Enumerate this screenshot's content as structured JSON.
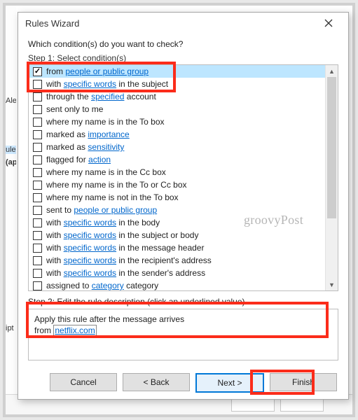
{
  "window": {
    "title": "Rules Wizard",
    "prompt": "Which condition(s) do you want to check?",
    "step1_label": "Step 1: Select condition(s)",
    "step2_label": "Step 2: Edit the rule description (click an underlined value)"
  },
  "left_fragments": {
    "a": "Ale",
    "b": "ule",
    "c": "(ap",
    "d": "ipt"
  },
  "conditions": [
    {
      "checked": true,
      "selected": true,
      "pre": "from ",
      "link": "people or public group",
      "post": ""
    },
    {
      "checked": false,
      "selected": false,
      "pre": "with ",
      "link": "specific words",
      "post": " in the subject"
    },
    {
      "checked": false,
      "selected": false,
      "pre": "through the ",
      "link": "specified",
      "post": " account"
    },
    {
      "checked": false,
      "selected": false,
      "pre": "sent only to me",
      "link": "",
      "post": ""
    },
    {
      "checked": false,
      "selected": false,
      "pre": "where my name is in the To box",
      "link": "",
      "post": ""
    },
    {
      "checked": false,
      "selected": false,
      "pre": "marked as ",
      "link": "importance",
      "post": ""
    },
    {
      "checked": false,
      "selected": false,
      "pre": "marked as ",
      "link": "sensitivity",
      "post": ""
    },
    {
      "checked": false,
      "selected": false,
      "pre": "flagged for ",
      "link": "action",
      "post": ""
    },
    {
      "checked": false,
      "selected": false,
      "pre": "where my name is in the Cc box",
      "link": "",
      "post": ""
    },
    {
      "checked": false,
      "selected": false,
      "pre": "where my name is in the To or Cc box",
      "link": "",
      "post": ""
    },
    {
      "checked": false,
      "selected": false,
      "pre": "where my name is not in the To box",
      "link": "",
      "post": ""
    },
    {
      "checked": false,
      "selected": false,
      "pre": "sent to ",
      "link": "people or public group",
      "post": ""
    },
    {
      "checked": false,
      "selected": false,
      "pre": "with ",
      "link": "specific words",
      "post": " in the body"
    },
    {
      "checked": false,
      "selected": false,
      "pre": "with ",
      "link": "specific words",
      "post": " in the subject or body"
    },
    {
      "checked": false,
      "selected": false,
      "pre": "with ",
      "link": "specific words",
      "post": " in the message header"
    },
    {
      "checked": false,
      "selected": false,
      "pre": "with ",
      "link": "specific words",
      "post": " in the recipient's address"
    },
    {
      "checked": false,
      "selected": false,
      "pre": "with ",
      "link": "specific words",
      "post": " in the sender's address"
    },
    {
      "checked": false,
      "selected": false,
      "pre": "assigned to ",
      "link": "category",
      "post": " category"
    }
  ],
  "description": {
    "line1": "Apply this rule after the message arrives",
    "line2_pre": "from ",
    "line2_link": "netflix.com"
  },
  "buttons": {
    "cancel": "Cancel",
    "back": "< Back",
    "next": "Next >",
    "finish": "Finish"
  },
  "watermark": "groovyPost"
}
